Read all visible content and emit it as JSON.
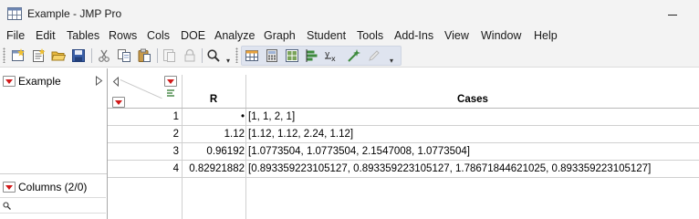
{
  "window": {
    "title": "Example - JMP Pro"
  },
  "menu": {
    "items": [
      "File",
      "Edit",
      "Tables",
      "Rows",
      "Cols",
      "DOE",
      "Analyze",
      "Graph",
      "Student",
      "Tools",
      "Add-Ins",
      "View",
      "Window",
      "Help"
    ]
  },
  "toolbar": {
    "buttons": [
      "new-data-table-icon",
      "new-script-icon",
      "open-folder-icon",
      "save-icon",
      "cut-icon",
      "copy-icon",
      "paste-icon",
      "copy-disabled-icon",
      "lock-icon",
      "search-icon",
      "data-table-icon",
      "calculator-icon",
      "layout-icon",
      "bar-chart-icon",
      "formula-icon",
      "wand-icon",
      "pencil-icon"
    ]
  },
  "panels": {
    "table_panel_label": "Example",
    "columns_panel_label": "Columns (2/0)",
    "columns_search_icon": "search-icon"
  },
  "table": {
    "columns": [
      "R",
      "Cases"
    ],
    "rows": [
      {
        "row": "1",
        "r": "•",
        "cases": "[1, 1, 2, 1]"
      },
      {
        "row": "2",
        "r": "1.12",
        "cases": "[1.12, 1.12, 2.24, 1.12]"
      },
      {
        "row": "3",
        "r": "0.96192",
        "cases": "[1.0773504, 1.0773504, 2.1547008, 1.0773504]"
      },
      {
        "row": "4",
        "r": "0.82921882",
        "cases": "[0.893359223105127, 0.893359223105127, 1.78671844621025, 0.893359223105127]"
      }
    ]
  },
  "colors": {
    "red_triangle": "#d11a1a",
    "chrome_bg": "#f3f3f3",
    "toolbar_strip": "#dfe4ef"
  }
}
